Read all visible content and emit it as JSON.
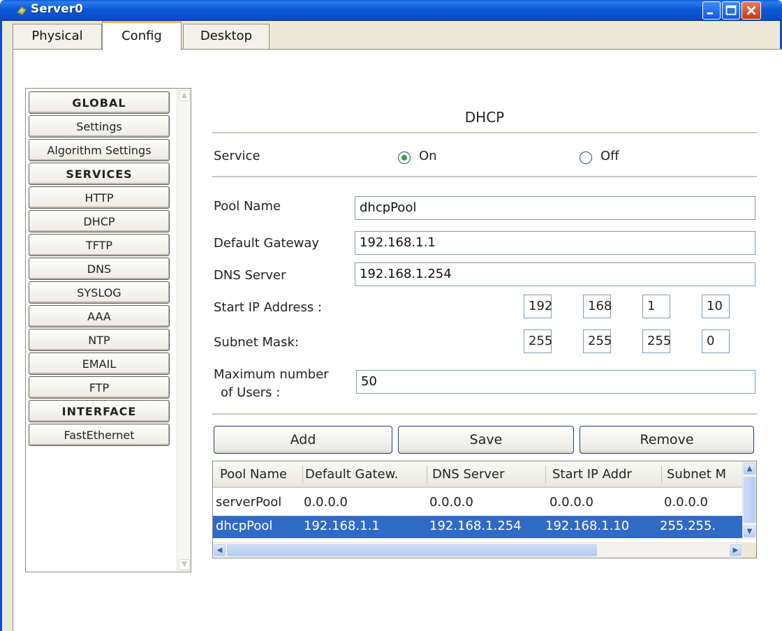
{
  "window": {
    "title": "Server0"
  },
  "tabs": [
    {
      "label": "Physical"
    },
    {
      "label": "Config"
    },
    {
      "label": "Desktop"
    }
  ],
  "nav": {
    "items": [
      {
        "label": "GLOBAL",
        "header": true
      },
      {
        "label": "Settings",
        "header": false
      },
      {
        "label": "Algorithm Settings",
        "header": false
      },
      {
        "label": "SERVICES",
        "header": true
      },
      {
        "label": "HTTP",
        "header": false
      },
      {
        "label": "DHCP",
        "header": false
      },
      {
        "label": "TFTP",
        "header": false
      },
      {
        "label": "DNS",
        "header": false
      },
      {
        "label": "SYSLOG",
        "header": false
      },
      {
        "label": "AAA",
        "header": false
      },
      {
        "label": "NTP",
        "header": false
      },
      {
        "label": "EMAIL",
        "header": false
      },
      {
        "label": "FTP",
        "header": false
      },
      {
        "label": "INTERFACE",
        "header": true
      },
      {
        "label": "FastEthernet",
        "header": false
      }
    ]
  },
  "dhcp": {
    "title": "DHCP",
    "service_label": "Service",
    "on_label": "On",
    "off_label": "Off",
    "service_state": "On",
    "pool_name_label": "Pool Name",
    "pool_name_value": "dhcpPool",
    "gateway_label": "Default Gateway",
    "gateway_value": "192.168.1.1",
    "dns_label": "DNS Server",
    "dns_value": "192.168.1.254",
    "start_ip_label": "Start IP Address :",
    "start_ip": [
      "192",
      "168",
      "1",
      "10"
    ],
    "mask_label": "Subnet Mask:",
    "mask": [
      "255",
      "255",
      "255",
      "0"
    ],
    "max_users_label_1": "Maximum number",
    "max_users_label_2": "of Users :",
    "max_users_value": "50"
  },
  "buttons": {
    "add": "Add",
    "save": "Save",
    "remove": "Remove"
  },
  "table": {
    "columns": [
      "Pool Name",
      "Default Gatew.",
      "DNS Server",
      "Start IP Addr",
      "Subnet M"
    ],
    "rows": [
      [
        "serverPool",
        "0.0.0.0",
        "0.0.0.0",
        "0.0.0.0",
        "0.0.0.0"
      ],
      [
        "dhcpPool",
        "192.168.1.1",
        "192.168.1.254",
        "192.168.1.10",
        "255.255."
      ]
    ],
    "selected_row": 1
  },
  "icons": {
    "title": "server-app-icon",
    "minimize": "minimize-icon",
    "maximize": "maximize-icon",
    "close": "close-icon"
  },
  "colors": {
    "titlebar": "#0b4fc6",
    "selection": "#316ac5",
    "active_tab_accent": "#f0b64a"
  }
}
